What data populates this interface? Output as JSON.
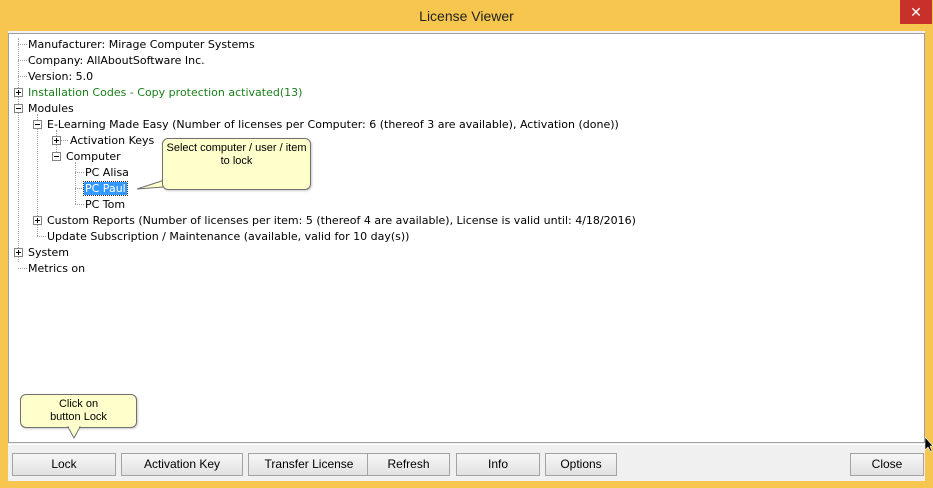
{
  "window": {
    "title": "License Viewer"
  },
  "tree": {
    "manufacturer": "Manufacturer: Mirage Computer Systems",
    "company": "Company: AllAboutSoftware Inc.",
    "version": "Version: 5.0",
    "installation_codes": "Installation Codes - Copy protection activated(13)",
    "modules": "Modules",
    "elearning": "E-Learning Made Easy (Number of licenses per Computer: 6 (thereof 3 are available), Activation (done))",
    "activation_keys": "Activation Keys",
    "computer": "Computer",
    "pc_alisa": "PC Alisa",
    "pc_paul": "PC Paul",
    "pc_tom": "PC Tom",
    "custom_reports": "Custom Reports (Number of licenses per item: 5 (thereof 4 are available), License is valid until: 4/18/2016)",
    "update_subscription": "Update Subscription / Maintenance (available, valid for 10 day(s))",
    "system": "System",
    "metrics": "Metrics on"
  },
  "callouts": {
    "select_line1": "Select computer / user / item",
    "select_line2": "to lock",
    "click_line1": "Click on",
    "click_line2": "button Lock"
  },
  "buttons": {
    "lock": "Lock",
    "activation_key": "Activation Key",
    "transfer_license": "Transfer License",
    "refresh": "Refresh",
    "info": "Info",
    "options": "Options",
    "close": "Close"
  }
}
